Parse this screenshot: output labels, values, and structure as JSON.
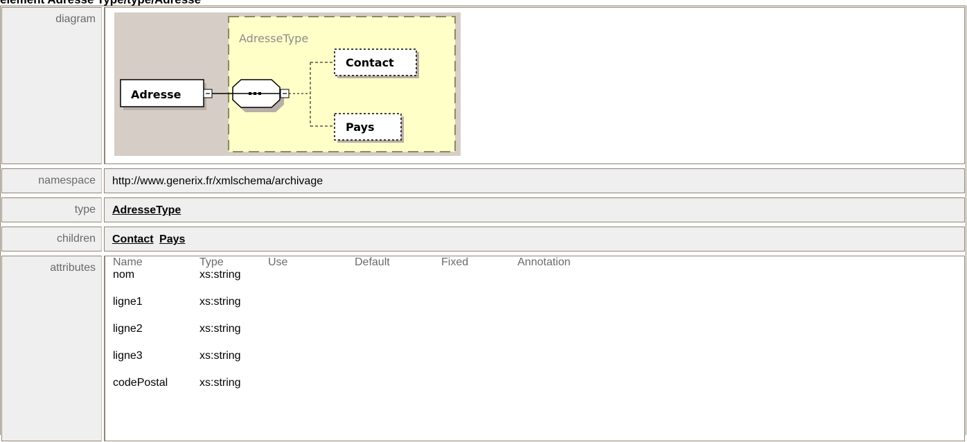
{
  "heading": "element Adresse Type/type/Adresse",
  "rows": {
    "diagram": {
      "label": "diagram",
      "element_name": "Adresse",
      "complex_type_name": "AdresseType",
      "children": [
        "Contact",
        "Pays"
      ]
    },
    "namespace": {
      "label": "namespace",
      "value": "http://www.generix.fr/xmlschema/archivage"
    },
    "type": {
      "label": "type",
      "value": "AdresseType"
    },
    "children": {
      "label": "children",
      "items": [
        "Contact",
        "Pays"
      ]
    },
    "attributes": {
      "label": "attributes",
      "columns": [
        "Name",
        "Type",
        "Use",
        "Default",
        "Fixed",
        "Annotation"
      ],
      "rows": [
        {
          "name": "nom",
          "type": "xs:string"
        },
        {
          "name": "ligne1",
          "type": "xs:string"
        },
        {
          "name": "ligne2",
          "type": "xs:string"
        },
        {
          "name": "ligne3",
          "type": "xs:string"
        },
        {
          "name": "codePostal",
          "type": "xs:string"
        }
      ]
    }
  },
  "colors": {
    "border": "#8f8473",
    "label_bg": "#f0efef",
    "diagram_bg": "#d6cdc6",
    "type_box_bg": "#ffffc8",
    "type_box_border": "#8a8a60"
  }
}
